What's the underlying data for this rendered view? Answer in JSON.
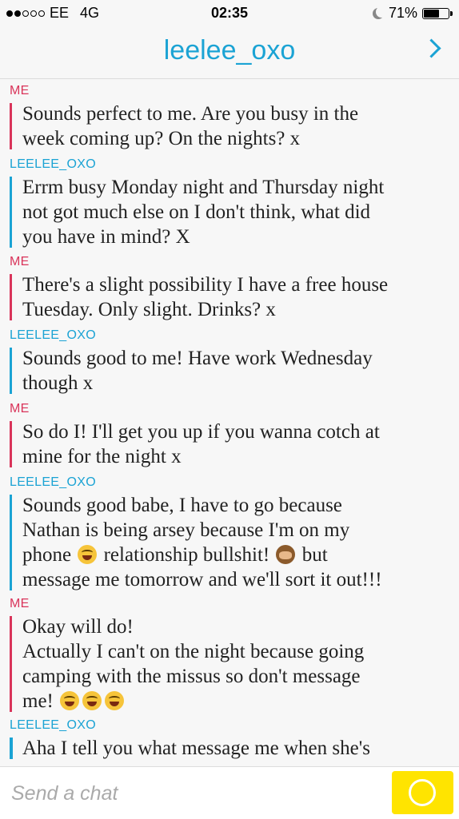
{
  "status_bar": {
    "carrier": "EE",
    "network": "4G",
    "time": "02:35",
    "battery": "71%",
    "battery_level": 0.71
  },
  "header": {
    "title": "leelee_oxo"
  },
  "colors": {
    "me": "#d9345a",
    "other": "#1ba3d4",
    "send": "#ffe400"
  },
  "messages": [
    {
      "sender": "ME",
      "from": "me",
      "text": "Sounds perfect to me. Are you busy in the\nweek coming up? On the nights? x"
    },
    {
      "sender": "LEELEE_OXO",
      "from": "other",
      "text": "Errm busy Monday night and Thursday night\nnot got much else on I don't think, what did\nyou have in mind? X"
    },
    {
      "sender": "ME",
      "from": "me",
      "text": "There's a slight possibility I have a free house\nTuesday. Only slight. Drinks? x"
    },
    {
      "sender": "LEELEE_OXO",
      "from": "other",
      "text": "Sounds good to me! Have work Wednesday\nthough x"
    },
    {
      "sender": "ME",
      "from": "me",
      "text": "So do I! I'll get you up if you wanna cotch at\nmine for the night x"
    },
    {
      "sender": "LEELEE_OXO",
      "from": "other",
      "line1": "Sounds good babe, I have to go because",
      "line2": "Nathan is being arsey because I'm on my",
      "line3a": "phone ",
      "line3b": " relationship bullshit! ",
      "line3c": " but",
      "line4": "message me tomorrow and we'll sort it out!!!"
    },
    {
      "sender": "ME",
      "from": "me",
      "text": "Okay will do!\nActually I can't on the night because going\ncamping with the missus so don't message\nme! "
    },
    {
      "sender": "LEELEE_OXO",
      "from": "other",
      "text": "Aha I tell you what message me when she's"
    }
  ],
  "composer": {
    "placeholder": "Send a chat"
  }
}
